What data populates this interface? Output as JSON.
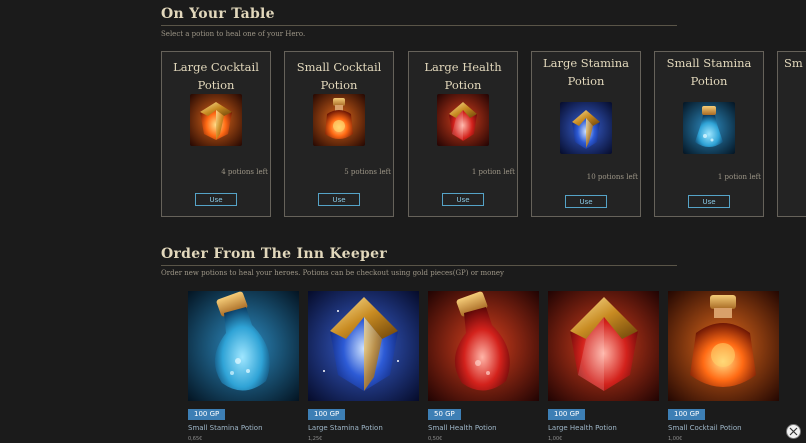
{
  "table": {
    "title": "On Your Table",
    "subtitle": "Select a potion to heal one of your Hero.",
    "cards": [
      {
        "name": "Large Cocktail Potion",
        "left": "4 potions left",
        "button": "Use",
        "icon": "large-cocktail-potion-icon"
      },
      {
        "name": "Small Cocktail Potion",
        "left": "5 potions left",
        "button": "Use",
        "icon": "small-cocktail-potion-icon"
      },
      {
        "name": "Large Health Potion",
        "left": "1 potion left",
        "button": "Use",
        "icon": "large-health-potion-icon"
      },
      {
        "name": "Large Stamina Potion",
        "left": "10 potions left",
        "button": "Use",
        "icon": "large-stamina-potion-icon"
      },
      {
        "name": "Small Stamina Potion",
        "left": "1 potion left",
        "button": "Use",
        "icon": "small-stamina-potion-icon"
      },
      {
        "name": "Sm",
        "icon": "truncated-card"
      }
    ]
  },
  "shop": {
    "title": "Order From The Inn Keeper",
    "subtitle": "Order new potions to heal your heroes. Potions can be checkout using gold pieces(GP) or money",
    "items": [
      {
        "price": "100 GP",
        "name": "Small Stamina Potion",
        "money": "0,65€",
        "icon": "small-stamina-potion-icon"
      },
      {
        "price": "100 GP",
        "name": "Large Stamina Potion",
        "money": "1,25€",
        "icon": "large-stamina-potion-icon"
      },
      {
        "price": "50 GP",
        "name": "Small Health Potion",
        "money": "0,50€",
        "icon": "small-health-potion-icon"
      },
      {
        "price": "100 GP",
        "name": "Large Health Potion",
        "money": "1,00€",
        "icon": "large-health-potion-icon"
      },
      {
        "price": "100 GP",
        "name": "Small Cocktail Potion",
        "money": "1,00€",
        "icon": "small-cocktail-potion-icon"
      }
    ]
  },
  "colors": {
    "background": "#1b1b1b",
    "accent_blue": "#3d7fb5",
    "text_gold": "#e2d8bc"
  },
  "close_icon": "close-icon"
}
